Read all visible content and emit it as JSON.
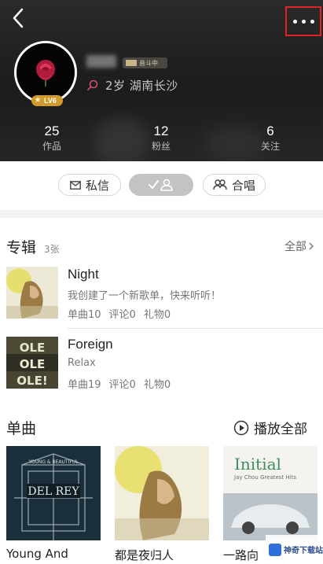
{
  "profile": {
    "age_location": "2岁 湖南长沙",
    "level_badge": "LV6",
    "member_tag": "音斗中"
  },
  "stats": [
    {
      "value": "25",
      "label": "作品"
    },
    {
      "value": "12",
      "label": "粉丝"
    },
    {
      "value": "6",
      "label": "关注"
    }
  ],
  "actions": {
    "message": "私信",
    "duet": "合唱"
  },
  "albums": {
    "title": "专辑",
    "count": "3张",
    "see_all": "全部",
    "items": [
      {
        "title": "Night",
        "desc": "我创建了一个新歌单，快来听听！",
        "songs": "单曲10",
        "comments": "评论0",
        "gifts": "礼物0"
      },
      {
        "title": "Foreign",
        "desc": "Relax",
        "songs": "单曲19",
        "comments": "评论0",
        "gifts": "礼物0"
      }
    ]
  },
  "singles": {
    "title": "单曲",
    "play_all": "播放全部",
    "items": [
      {
        "title": "Young And"
      },
      {
        "title": "都是夜归人"
      },
      {
        "title": "一路向"
      }
    ]
  },
  "watermark": "神奇下载站",
  "colors": {
    "highlight_box": "#e02424",
    "level_badge": "#d09a2a"
  },
  "icons": [
    "back-icon",
    "more-icon",
    "location-icon",
    "mail-icon",
    "check-user-icon",
    "duet-icon",
    "chevron-right-icon",
    "play-circle-icon"
  ]
}
